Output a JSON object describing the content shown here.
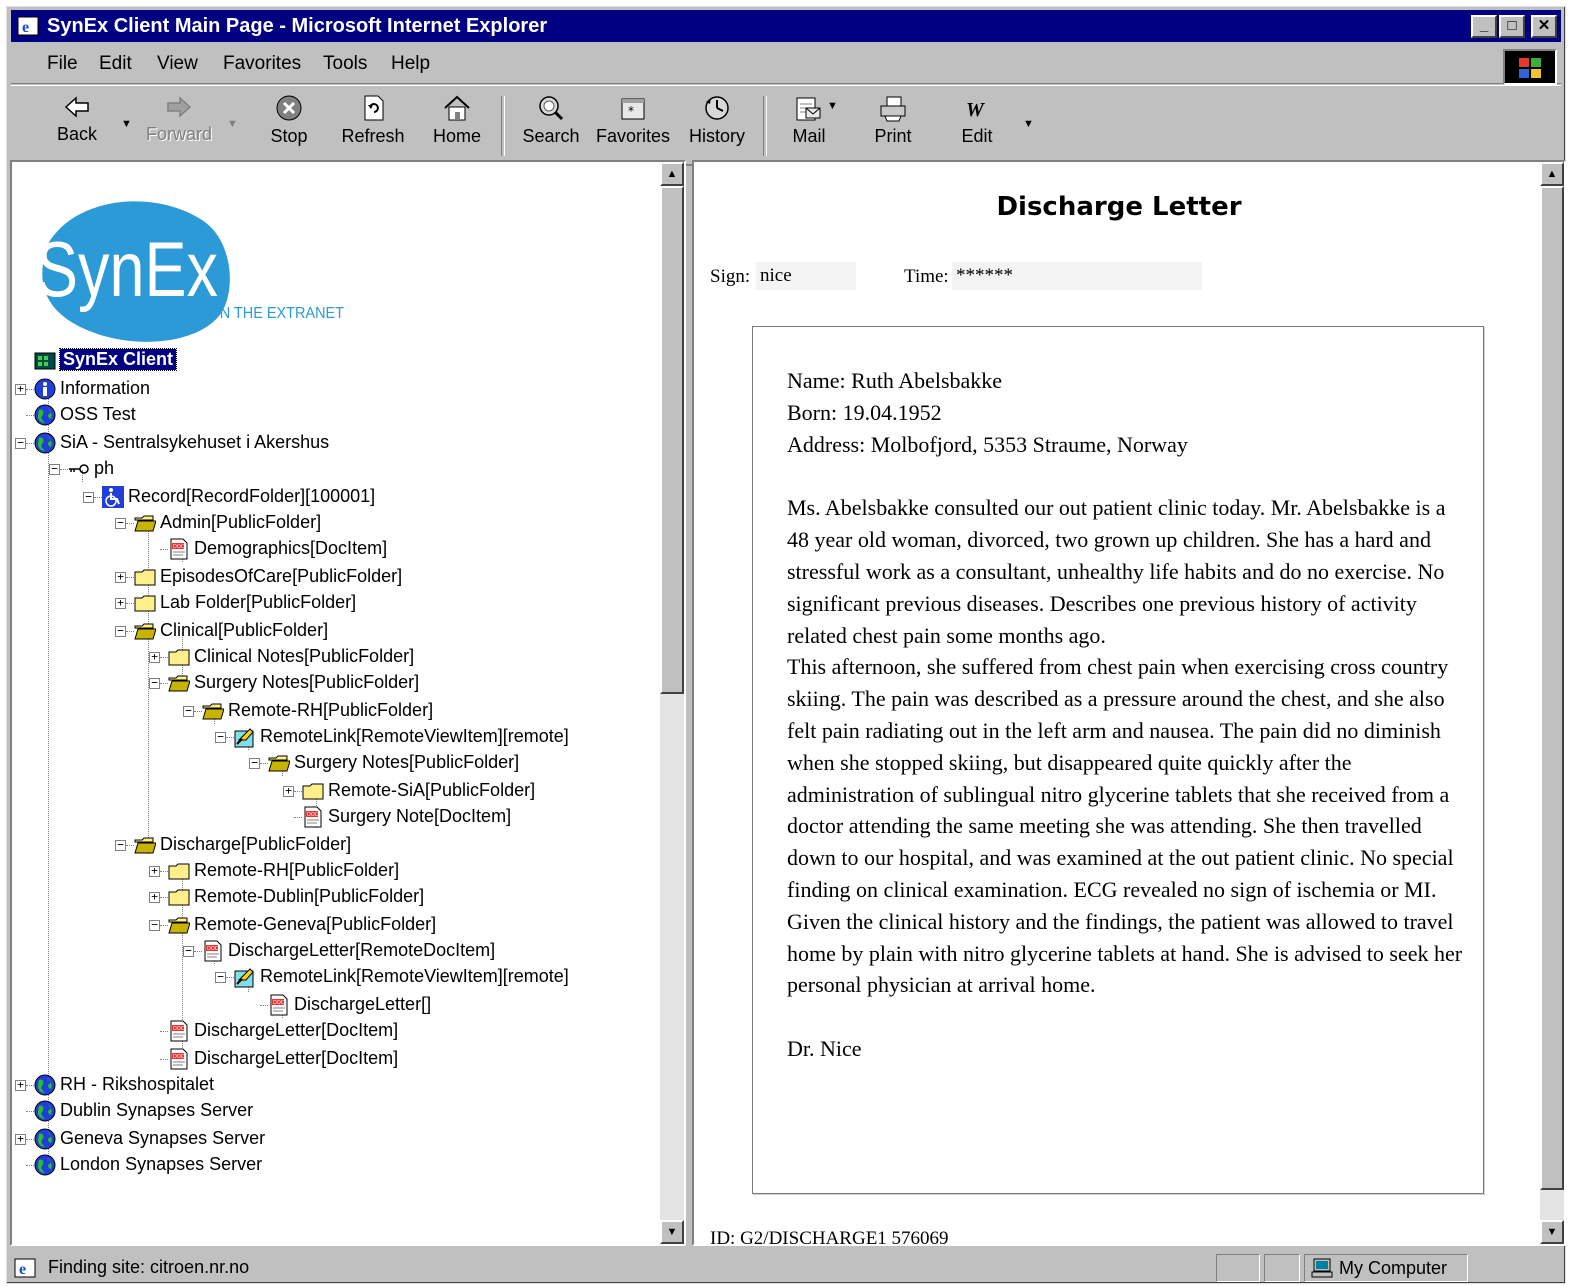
{
  "window": {
    "title": "SynEx Client Main Page - Microsoft Internet Explorer",
    "minimize_glyph": "_",
    "maximize_glyph": "□",
    "close_glyph": "✕"
  },
  "menu": {
    "items": [
      {
        "label": "File"
      },
      {
        "label": "Edit"
      },
      {
        "label": "View"
      },
      {
        "label": "Favorites"
      },
      {
        "label": "Tools"
      },
      {
        "label": "Help"
      }
    ]
  },
  "toolbar": {
    "buttons": [
      {
        "label": "Back",
        "icon": "back-arrow-icon",
        "enabled": true
      },
      {
        "label": "Forward",
        "icon": "forward-arrow-icon",
        "enabled": false
      },
      {
        "label": "Stop",
        "icon": "stop-icon",
        "enabled": true
      },
      {
        "label": "Refresh",
        "icon": "refresh-icon",
        "enabled": true
      },
      {
        "label": "Home",
        "icon": "home-icon",
        "enabled": true
      },
      {
        "label": "Search",
        "icon": "search-icon",
        "enabled": true
      },
      {
        "label": "Favorites",
        "icon": "favorites-icon",
        "enabled": true
      },
      {
        "label": "History",
        "icon": "history-icon",
        "enabled": true
      },
      {
        "label": "Mail",
        "icon": "mail-icon",
        "enabled": true
      },
      {
        "label": "Print",
        "icon": "print-icon",
        "enabled": true
      },
      {
        "label": "Edit",
        "icon": "edit-icon",
        "enabled": true
      }
    ]
  },
  "logo": {
    "main": "SynEx",
    "tagline": "SYNERGY ON THE EXTRANET"
  },
  "tree": {
    "root": "SynEx Client",
    "nodes": [
      {
        "label": "Information",
        "icon": "info-icon"
      },
      {
        "label": "OSS Test",
        "icon": "globe-icon"
      },
      {
        "label": "SiA - Sentralsykehuset i Akershus",
        "icon": "globe-icon"
      },
      {
        "label": "ph",
        "icon": "key-icon"
      },
      {
        "label": "Record[RecordFolder][100001]",
        "icon": "wheelchair-icon"
      },
      {
        "label": "Admin[PublicFolder]",
        "icon": "open-folder-icon"
      },
      {
        "label": "Demographics[DocItem]",
        "icon": "document-icon"
      },
      {
        "label": "EpisodesOfCare[PublicFolder]",
        "icon": "folder-icon"
      },
      {
        "label": "Lab Folder[PublicFolder]",
        "icon": "folder-icon"
      },
      {
        "label": "Clinical[PublicFolder]",
        "icon": "open-folder-icon"
      },
      {
        "label": "Clinical Notes[PublicFolder]",
        "icon": "folder-icon"
      },
      {
        "label": "Surgery Notes[PublicFolder]",
        "icon": "open-folder-icon"
      },
      {
        "label": "Remote-RH[PublicFolder]",
        "icon": "open-folder-icon"
      },
      {
        "label": "RemoteLink[RemoteViewItem][remote]",
        "icon": "remote-link-icon"
      },
      {
        "label": "Surgery Notes[PublicFolder]",
        "icon": "open-folder-icon"
      },
      {
        "label": "Remote-SiA[PublicFolder]",
        "icon": "folder-icon"
      },
      {
        "label": "Surgery Note[DocItem]",
        "icon": "document-icon"
      },
      {
        "label": "Discharge[PublicFolder]",
        "icon": "open-folder-icon"
      },
      {
        "label": "Remote-RH[PublicFolder]",
        "icon": "folder-icon"
      },
      {
        "label": "Remote-Dublin[PublicFolder]",
        "icon": "folder-icon"
      },
      {
        "label": "Remote-Geneva[PublicFolder]",
        "icon": "open-folder-icon"
      },
      {
        "label": "DischargeLetter[RemoteDocItem]",
        "icon": "document-icon"
      },
      {
        "label": "RemoteLink[RemoteViewItem][remote]",
        "icon": "remote-link-icon"
      },
      {
        "label": "DischargeLetter[]",
        "icon": "document-icon"
      },
      {
        "label": "DischargeLetter[DocItem]",
        "icon": "document-icon"
      },
      {
        "label": "DischargeLetter[DocItem]",
        "icon": "document-icon"
      },
      {
        "label": "RH - Rikshospitalet",
        "icon": "globe-icon"
      },
      {
        "label": "Dublin Synapses Server",
        "icon": "globe-icon"
      },
      {
        "label": "Geneva Synapses Server",
        "icon": "globe-icon"
      },
      {
        "label": "London Synapses Server",
        "icon": "globe-icon"
      }
    ]
  },
  "document": {
    "title": "Discharge Letter",
    "sign_label": "Sign:",
    "sign_value": "nice",
    "time_label": "Time:",
    "time_value": "******",
    "name_line": "Name: Ruth Abelsbakke",
    "born_line": "Born: 19.04.1952",
    "address_line": "Address: Molbofjord, 5353 Straume, Norway",
    "paragraph1": "Ms. Abelsbakke consulted our out patient clinic today. Mr. Abelsbakke is a 48 year old woman, divorced, two grown up children. She has a hard and stressful work as a consultant, unhealthy life habits and do no exercise. No significant previous diseases. Describes one previous history of activity related chest pain some months ago.",
    "paragraph2": "This afternoon, she suffered from chest pain when exercising cross country skiing. The pain was described as a pressure around the chest, and she also felt pain radiating out in the left arm and nausea. The pain did no diminish when she stopped skiing, but disappeared quite quickly after the administration of sublingual nitro glycerine tablets that she received from a doctor attending the same meeting she was attending. She then travelled down to our hospital, and was examined at the out patient clinic. No special finding on clinical examination. ECG revealed no sign of ischemia or MI.",
    "paragraph3": "Given the clinical history and the findings, the patient was allowed to travel home by plain with nitro glycerine tablets at hand. She is advised to seek her personal physician at arrival home.",
    "signature": "Dr. Nice",
    "id_line": "ID: G2/DISCHARGE1  576069"
  },
  "status": {
    "message": "Finding site: citroen.nr.no",
    "zone": "My Computer"
  }
}
